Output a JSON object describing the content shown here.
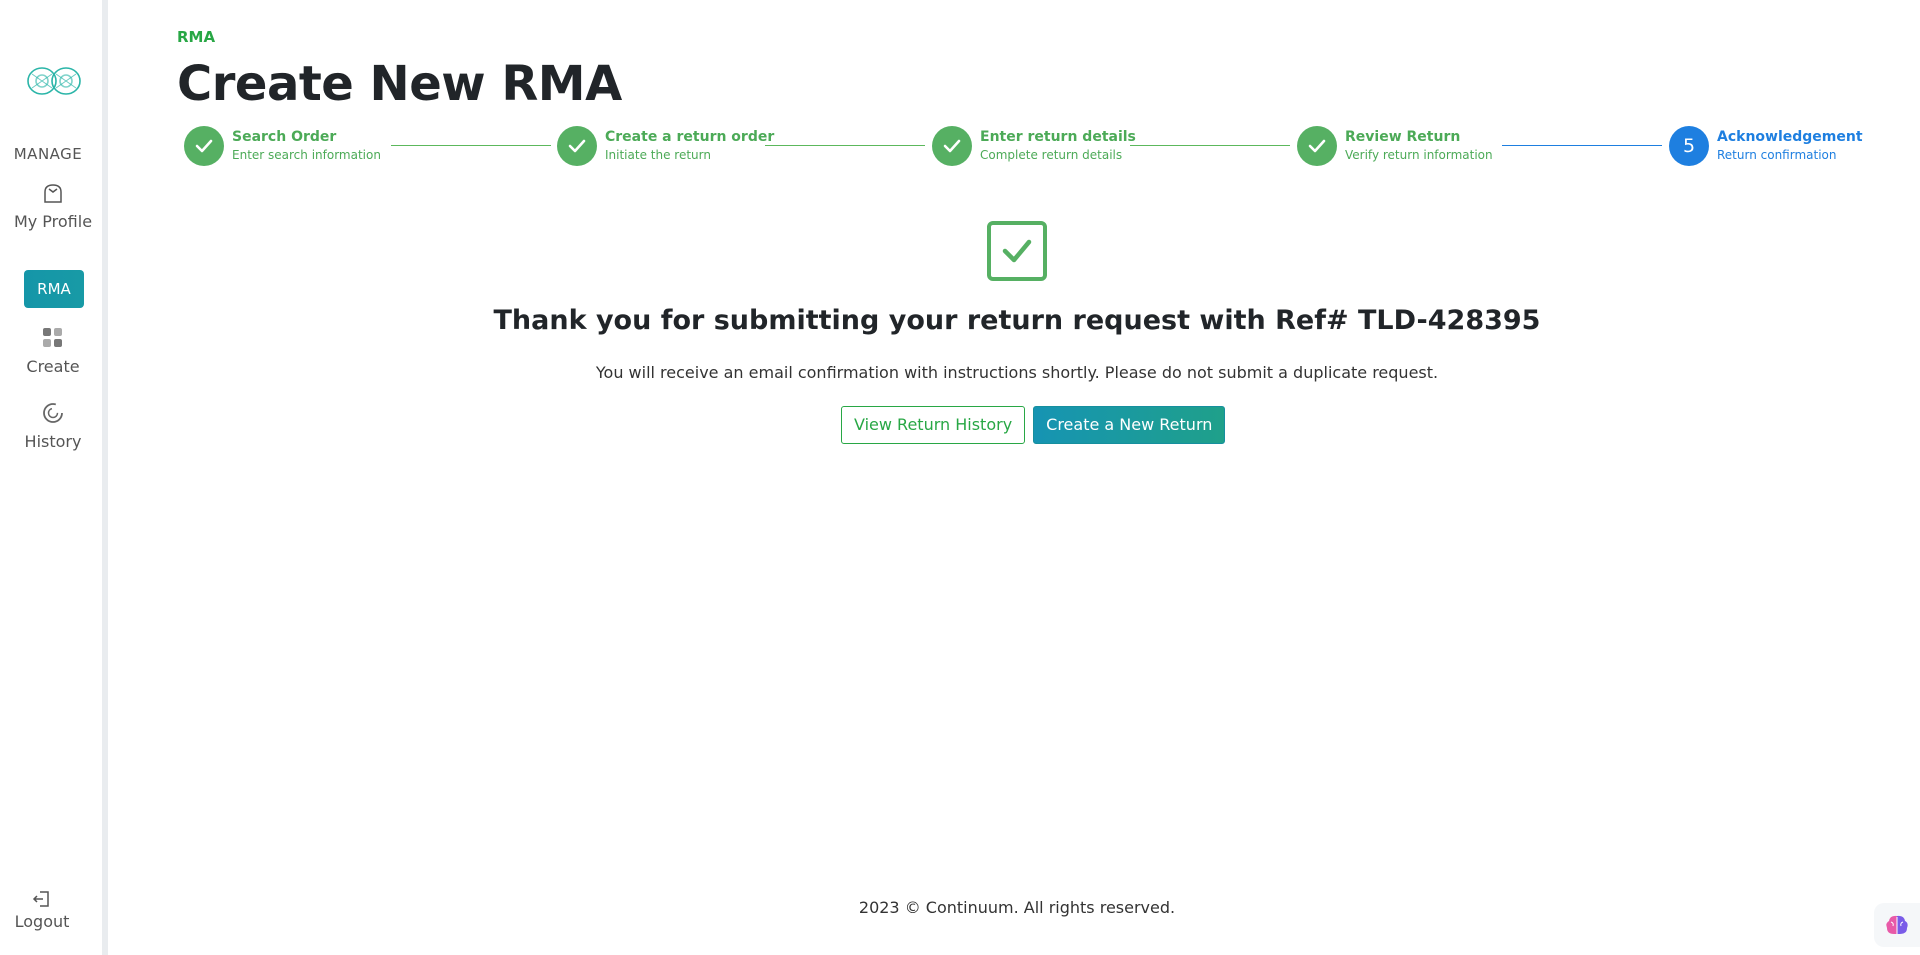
{
  "sidebar": {
    "manage_label": "MANAGE",
    "profile_label": "My Profile",
    "rma_badge": "RMA",
    "create_label": "Create",
    "history_label": "History",
    "logout_label": "Logout"
  },
  "header": {
    "eyebrow": "RMA",
    "title": "Create New RMA"
  },
  "stepper": {
    "steps": [
      {
        "title": "Search Order",
        "subtitle": "Enter search information",
        "status": "done"
      },
      {
        "title": "Create a return order",
        "subtitle": "Initiate the return",
        "status": "done"
      },
      {
        "title": "Enter return details",
        "subtitle": "Complete return details",
        "status": "done"
      },
      {
        "title": "Review Return",
        "subtitle": "Verify return information",
        "status": "done"
      },
      {
        "title": "Acknowledgement",
        "subtitle": "Return confirmation",
        "status": "active",
        "number": "5"
      }
    ]
  },
  "confirmation": {
    "heading": "Thank you for submitting your return request with Ref# TLD-428395",
    "note": "You will receive an email confirmation with instructions shortly. Please do not submit a duplicate request.",
    "view_history_button": "View Return History",
    "new_return_button": "Create a New Return"
  },
  "footer": {
    "text": "2023 © Continuum. All rights reserved."
  },
  "colors": {
    "success": "#56b063",
    "active": "#1e7fe0",
    "brand": "#1596a8"
  }
}
